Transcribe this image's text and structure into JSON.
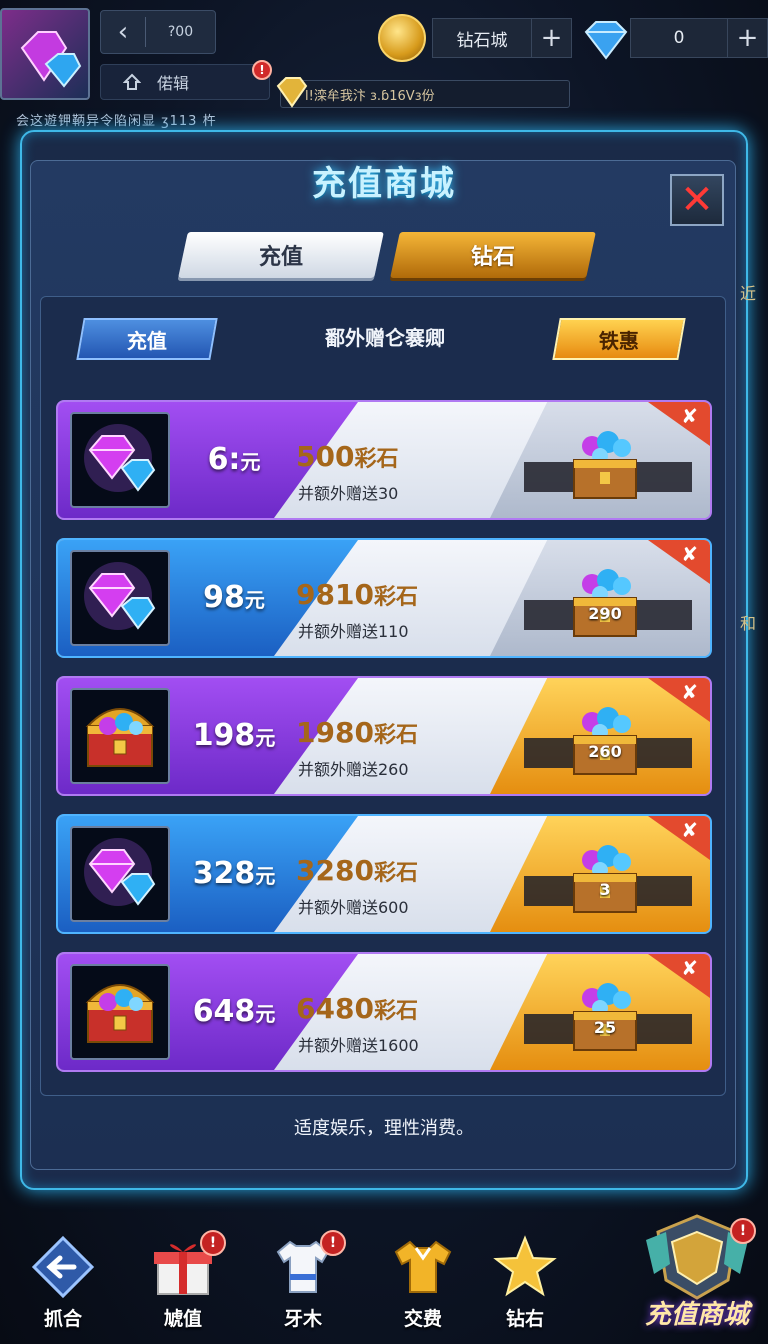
{
  "top": {
    "back_value": "?00",
    "user_label": "偌辑",
    "user_badge": "!",
    "gold_box_text": "l!滦牟我汴 ɜ.ɓ16Vɜ份",
    "ticker_text": "会这遊钾鞆异令陷闲显 ʒ113 杵",
    "currency_1": {
      "label": "钻石城",
      "plus": "+"
    },
    "currency_2": {
      "label": "0",
      "plus": "+"
    }
  },
  "modal": {
    "title": "充值商城",
    "close": "✕",
    "tabs": [
      {
        "label": "充值",
        "state": "inactive"
      },
      {
        "label": "钻石",
        "state": "active"
      }
    ],
    "sub_left": "充值",
    "sub_center": "鄱外赠仑褰卿",
    "sub_right": "铁惠"
  },
  "products": [
    {
      "price": "6:",
      "unit": "元",
      "amount": "500",
      "amount_unit": "彩石",
      "bonus": "并额外赠送30",
      "reward": "",
      "corner": "✘",
      "theme": "purple",
      "icon": "gems-icon"
    },
    {
      "price": "98",
      "unit": "元",
      "amount": "9810",
      "amount_unit": "彩石",
      "bonus": "并额外赠送110",
      "reward": "290",
      "corner": "✘",
      "theme": "blue",
      "icon": "gems-icon"
    },
    {
      "price": "198",
      "unit": "元",
      "amount": "1980",
      "amount_unit": "彩石",
      "bonus": "并额外赠送260",
      "reward": "260",
      "corner": "✘",
      "theme": "purple-gold",
      "icon": "treasure-chest-icon"
    },
    {
      "price": "328",
      "unit": "元",
      "amount": "3280",
      "amount_unit": "彩石",
      "bonus": "并额外赠送600",
      "reward": "3",
      "corner": "✘",
      "theme": "blue-gold",
      "icon": "gems-icon"
    },
    {
      "price": "648",
      "unit": "元",
      "amount": "6480",
      "amount_unit": "彩石",
      "bonus": "并额外赠送1600",
      "reward": "25",
      "corner": "✘",
      "theme": "purple-gold",
      "icon": "treasure-chest-icon"
    }
  ],
  "footer_note": "适度娱乐，理性消费。",
  "nav": [
    {
      "label": "抓合",
      "icon": "back-arrow-icon",
      "badge": ""
    },
    {
      "label": "虓值",
      "icon": "gift-box-icon",
      "badge": "!"
    },
    {
      "label": "牙木",
      "icon": "shirt-icon",
      "badge": "!"
    },
    {
      "label": "交费",
      "icon": "jersey-icon",
      "badge": ""
    },
    {
      "label": "钻右",
      "icon": "star-icon",
      "badge": ""
    },
    {
      "label": "充值商城",
      "icon": "shop-emblem-icon",
      "badge": "!"
    }
  ],
  "side_hints": [
    "近",
    "和"
  ],
  "colors": {
    "frame_glow": "#3fb9e8",
    "purple": "#8a47e6",
    "blue": "#2e8ee8",
    "gold": "#f2a81c",
    "corner_red": "#e34a2e",
    "amount_text": "#a5661a"
  }
}
